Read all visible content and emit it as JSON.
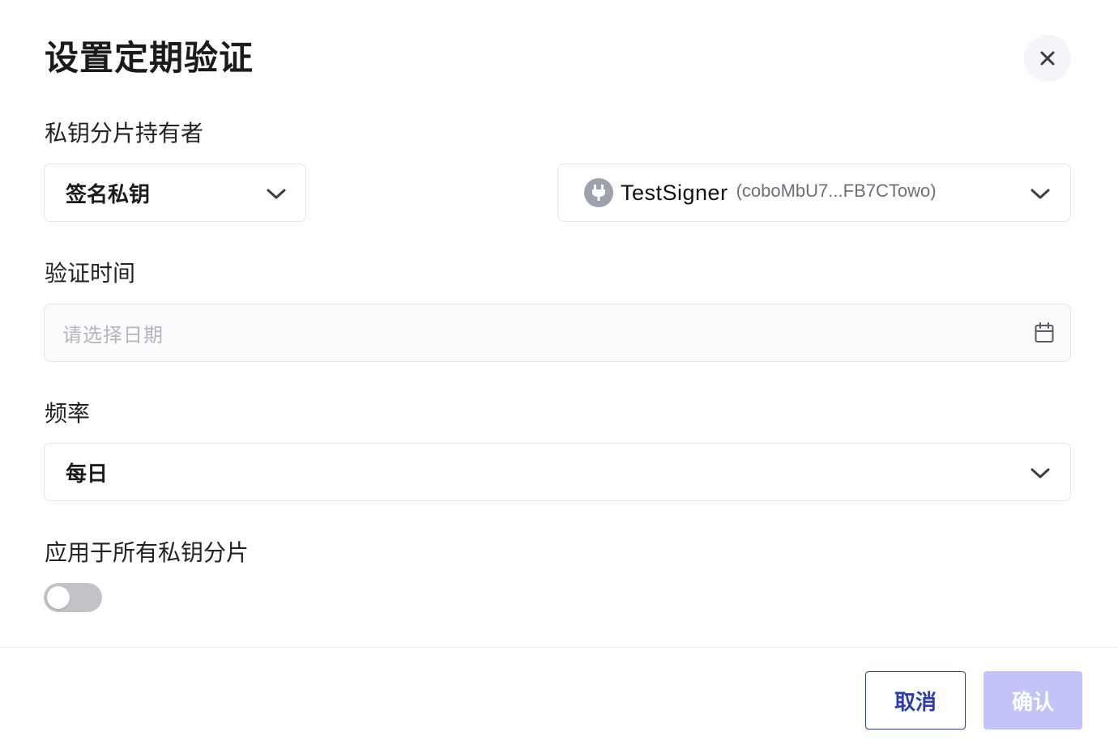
{
  "dialog": {
    "title": "设置定期验证",
    "close_icon": "close-icon"
  },
  "holder": {
    "label": "私钥分片持有者",
    "key_type": {
      "value": "签名私钥",
      "icon": "chevron-down-icon"
    },
    "signer": {
      "name": "TestSigner",
      "id": "(coboMbU7...FB7CTowo)",
      "icon": "plug-icon",
      "dropdown_icon": "chevron-down-icon"
    }
  },
  "verify_time": {
    "label": "验证时间",
    "placeholder": "请选择日期",
    "icon": "calendar-icon"
  },
  "frequency": {
    "label": "频率",
    "value": "每日",
    "icon": "chevron-down-icon"
  },
  "apply_all": {
    "label": "应用于所有私钥分片",
    "enabled": false
  },
  "footer": {
    "cancel_label": "取消",
    "confirm_label": "确认"
  },
  "colors": {
    "primary": "#2b3bb5",
    "confirm_disabled_bg": "#c2c3f6",
    "toggle_off": "#c1c3c9"
  }
}
